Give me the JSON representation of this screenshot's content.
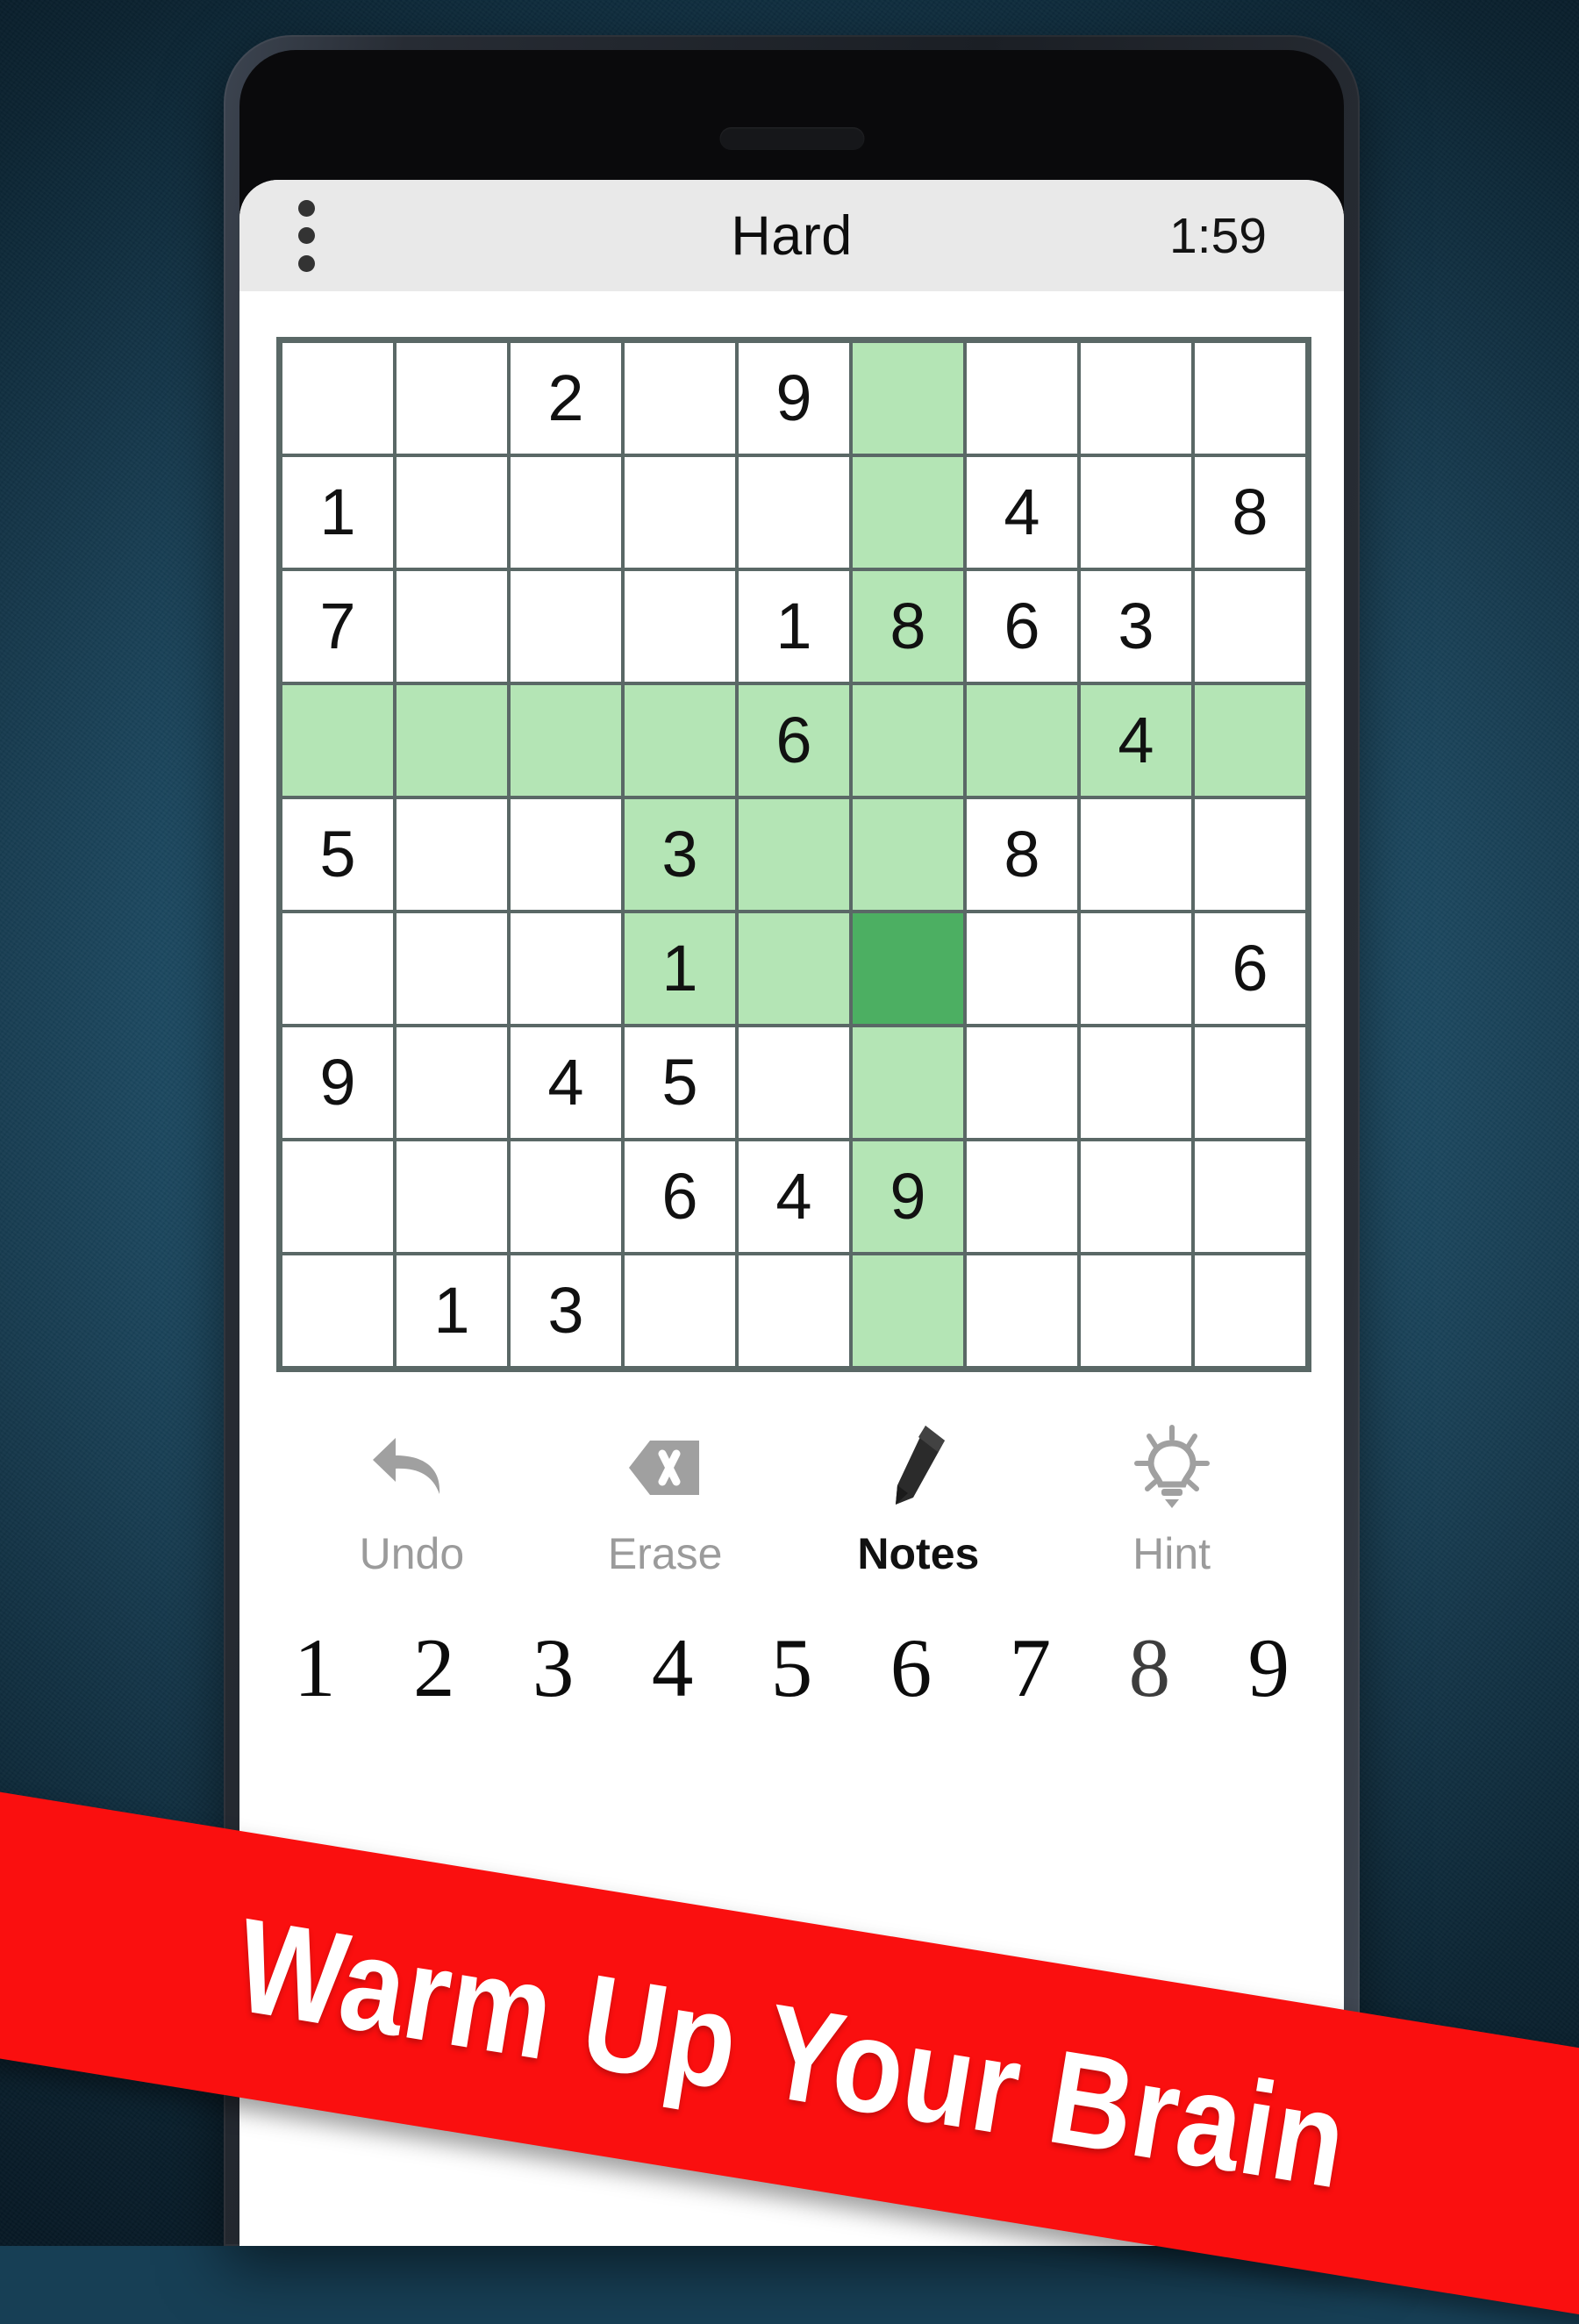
{
  "app": {
    "title": "Hard",
    "timer": "1:59",
    "menu_icon": "overflow-menu-icon"
  },
  "board": {
    "rows": [
      [
        "",
        "",
        "2",
        "",
        "9",
        "",
        "",
        "",
        ""
      ],
      [
        "1",
        "",
        "",
        "",
        "",
        "",
        "4",
        "",
        "8"
      ],
      [
        "7",
        "",
        "",
        "",
        "1",
        "8",
        "6",
        "3",
        ""
      ],
      [
        "",
        "",
        "",
        "",
        "6",
        "",
        "",
        "4",
        ""
      ],
      [
        "5",
        "",
        "",
        "3",
        "",
        "",
        "8",
        "",
        ""
      ],
      [
        "",
        "",
        "",
        "1",
        "",
        "",
        "",
        "",
        "6"
      ],
      [
        "9",
        "",
        "4",
        "5",
        "",
        "",
        "",
        "",
        ""
      ],
      [
        "",
        "",
        "",
        "6",
        "4",
        "9",
        "",
        "",
        ""
      ],
      [
        "",
        "1",
        "3",
        "",
        "",
        "",
        "",
        "",
        ""
      ]
    ],
    "highlighted": [
      [
        0,
        5
      ],
      [
        1,
        5
      ],
      [
        2,
        5
      ],
      [
        3,
        0
      ],
      [
        3,
        1
      ],
      [
        3,
        2
      ],
      [
        3,
        3
      ],
      [
        3,
        4
      ],
      [
        3,
        5
      ],
      [
        3,
        6
      ],
      [
        3,
        7
      ],
      [
        3,
        8
      ],
      [
        4,
        3
      ],
      [
        4,
        4
      ],
      [
        4,
        5
      ],
      [
        5,
        3
      ],
      [
        5,
        4
      ],
      [
        6,
        5
      ],
      [
        7,
        5
      ],
      [
        8,
        5
      ]
    ],
    "selected": [
      5,
      5
    ],
    "colors": {
      "highlight": "#b4e5b5",
      "selected": "#4caf62",
      "gridline": "#5a6866",
      "cell": "#ffffff",
      "digit": "#111111"
    }
  },
  "actions": [
    {
      "label": "Undo",
      "icon": "undo-arrow-icon",
      "active": false
    },
    {
      "label": "Erase",
      "icon": "erase-x-icon",
      "active": false
    },
    {
      "label": "Notes",
      "icon": "pencil-icon",
      "active": true
    },
    {
      "label": "Hint",
      "icon": "lightbulb-icon",
      "active": false
    }
  ],
  "numpad": [
    "1",
    "2",
    "3",
    "4",
    "5",
    "6",
    "7",
    "8",
    "9"
  ],
  "banner": {
    "text": "Warm Up Your Brain",
    "background": "#fa0f0f",
    "text_color": "#ffffff"
  }
}
